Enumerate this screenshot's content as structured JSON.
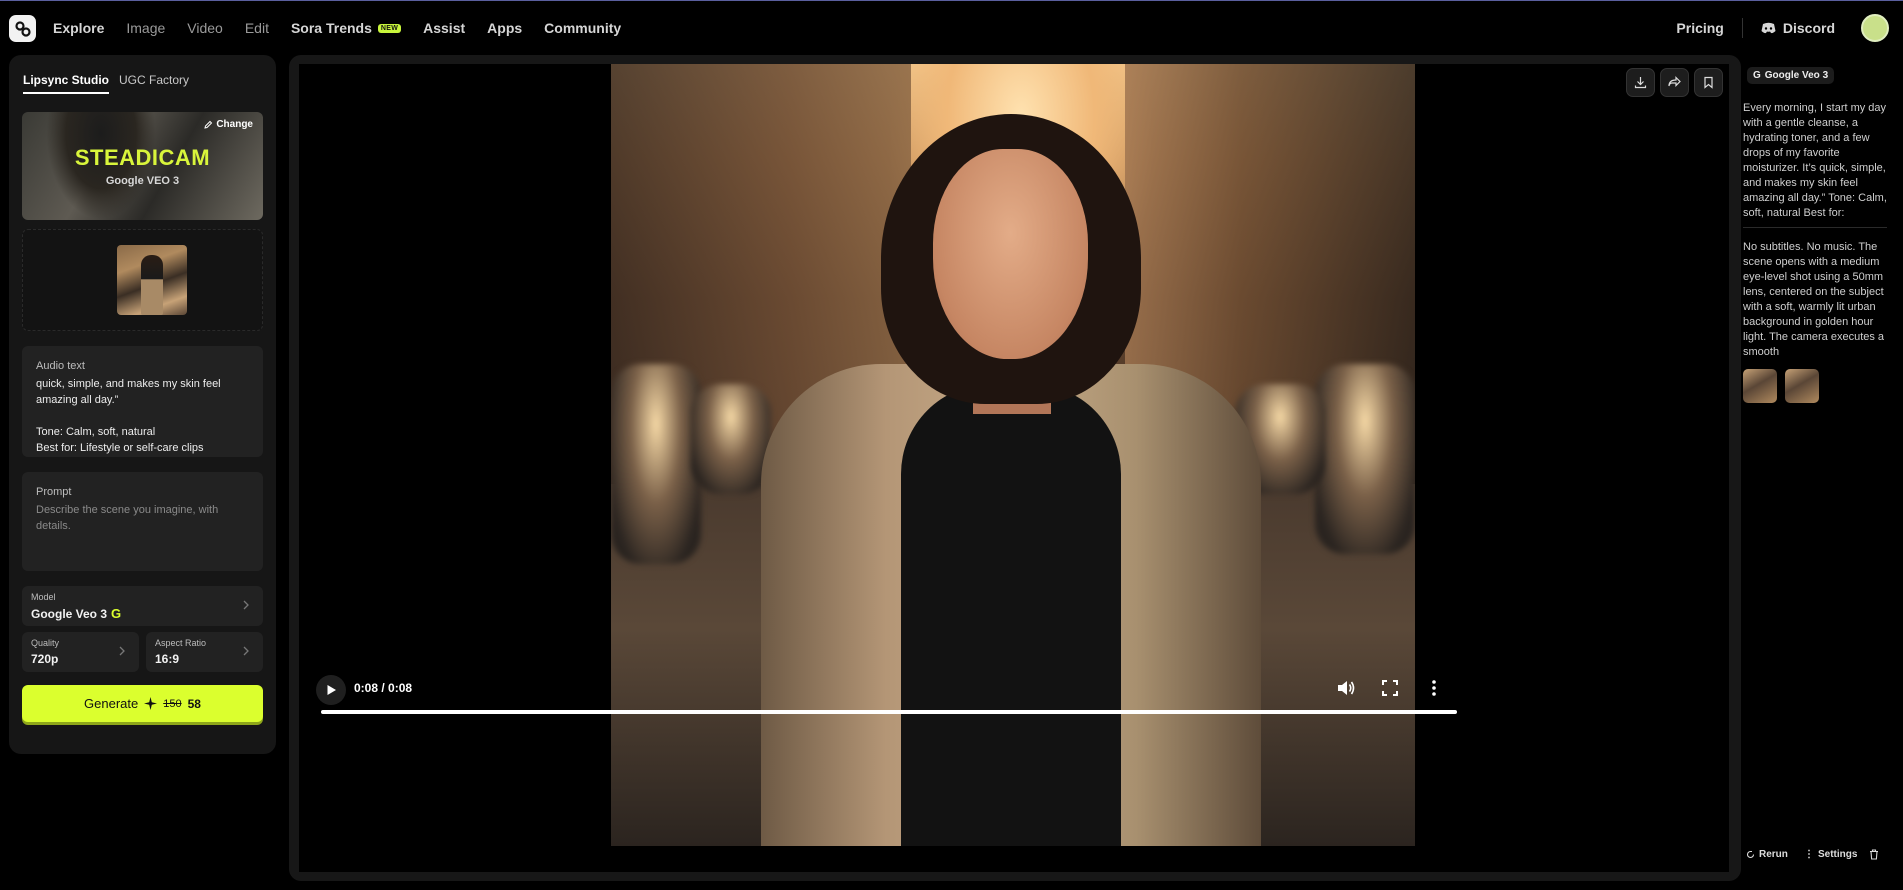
{
  "nav": {
    "items": [
      {
        "label": "Explore",
        "dim": false
      },
      {
        "label": "Image",
        "dim": true
      },
      {
        "label": "Video",
        "dim": true
      },
      {
        "label": "Edit",
        "dim": true
      },
      {
        "label": "Sora Trends",
        "dim": false,
        "badge": "NEW"
      },
      {
        "label": "Assist",
        "dim": false
      },
      {
        "label": "Apps",
        "dim": false
      },
      {
        "label": "Community",
        "dim": false
      }
    ],
    "pricing": "Pricing",
    "discord": "Discord"
  },
  "left": {
    "tabs": [
      "Lipsync Studio",
      "UGC Factory"
    ],
    "style_card": {
      "title": "STEADICAM",
      "subtitle": "Google VEO 3",
      "change": "Change"
    },
    "audio": {
      "label": "Audio text",
      "text": "quick, simple, and makes my skin feel amazing all day.”\n\nTone: Calm, soft, natural\nBest for: Lifestyle or self-care clips"
    },
    "prompt": {
      "label": "Prompt",
      "placeholder": "Describe the scene you imagine, with details."
    },
    "model": {
      "label": "Model",
      "value": "Google Veo 3",
      "mark": "G"
    },
    "quality": {
      "label": "Quality",
      "value": "720p"
    },
    "aspect": {
      "label": "Aspect Ratio",
      "value": "16:9"
    },
    "generate": {
      "label": "Generate",
      "cost_old": "150",
      "cost_new": "58"
    }
  },
  "player": {
    "time": "0:08 / 0:08",
    "progress": 1.0
  },
  "right": {
    "model_tag": "Google Veo 3",
    "text1": "Every morning, I start my day with a gentle cleanse, a hydrating toner, and a few drops of my favorite moisturizer. It’s quick, simple, and makes my skin feel amazing all day.” Tone: Calm, soft, natural Best for:",
    "text2": "No subtitles. No music. The scene opens with a medium eye-level shot using a 50mm lens, centered on the subject with a soft, warmly lit urban background in golden hour light. The camera executes a smooth",
    "rerun": "Rerun",
    "settings": "Settings"
  },
  "colors": {
    "accent": "#dbff2e",
    "background": "#000000",
    "panel": "#161616"
  }
}
